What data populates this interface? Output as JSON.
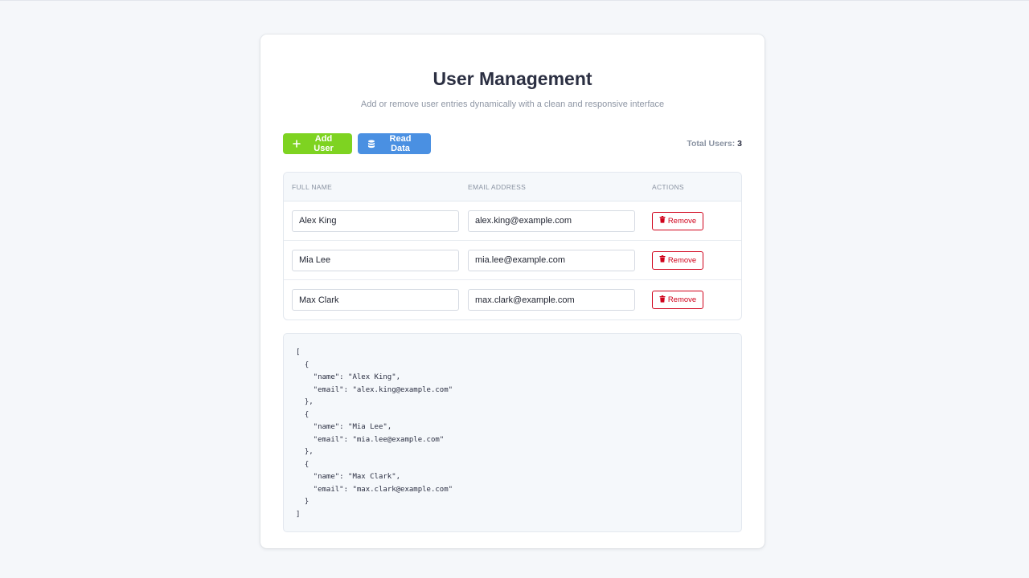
{
  "header": {
    "title": "User Management",
    "subtitle": "Add or remove user entries dynamically with a clean and responsive interface"
  },
  "toolbar": {
    "add_label": "Add User",
    "read_label": "Read Data",
    "total_label": "Total Users:",
    "total_count": "3",
    "add_color": "#7ed321",
    "read_color": "#4a90e2"
  },
  "table": {
    "columns": [
      "FULL NAME",
      "EMAIL ADDRESS",
      "ACTIONS"
    ],
    "rows": [
      {
        "name": "Alex King",
        "email": "alex.king@example.com",
        "action": "Remove"
      },
      {
        "name": "Mia Lee",
        "email": "mia.lee@example.com",
        "action": "Remove"
      },
      {
        "name": "Max Clark",
        "email": "max.clark@example.com",
        "action": "Remove"
      }
    ],
    "remove_color": "#d0021b"
  },
  "output": {
    "text": "[\n  {\n    \"name\": \"Alex King\",\n    \"email\": \"alex.king@example.com\"\n  },\n  {\n    \"name\": \"Mia Lee\",\n    \"email\": \"mia.lee@example.com\"\n  },\n  {\n    \"name\": \"Max Clark\",\n    \"email\": \"max.clark@example.com\"\n  }\n]"
  },
  "icons": {
    "add": "plus-icon",
    "read": "database-icon",
    "remove": "trash-icon"
  }
}
